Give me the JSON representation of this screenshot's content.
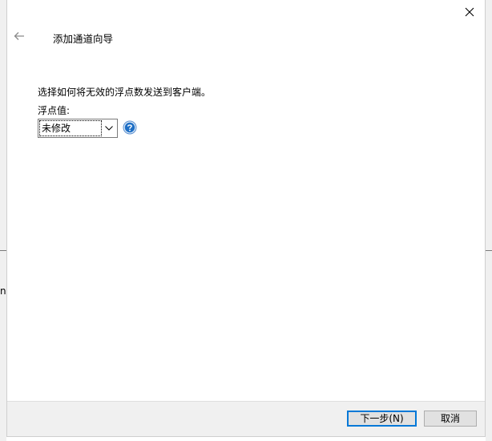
{
  "wizard": {
    "title": "添加通道向导",
    "instruction": "选择如何将无效的浮点数发送到客户端。",
    "field_label": "浮点值:",
    "float_value_selected": "未修改"
  },
  "footer": {
    "next_label": "下一步(N)",
    "cancel_label": "取消"
  },
  "background": {
    "fragment_text": "n"
  },
  "icons": {
    "close": "close-icon",
    "back": "back-arrow-icon",
    "dropdown": "chevron-down-icon",
    "help": "help-icon"
  },
  "colors": {
    "accent": "#0078d7",
    "help_blue": "#1f6fc5",
    "footer_bg": "#f0f0f0",
    "button_bg": "#e1e1e1"
  }
}
